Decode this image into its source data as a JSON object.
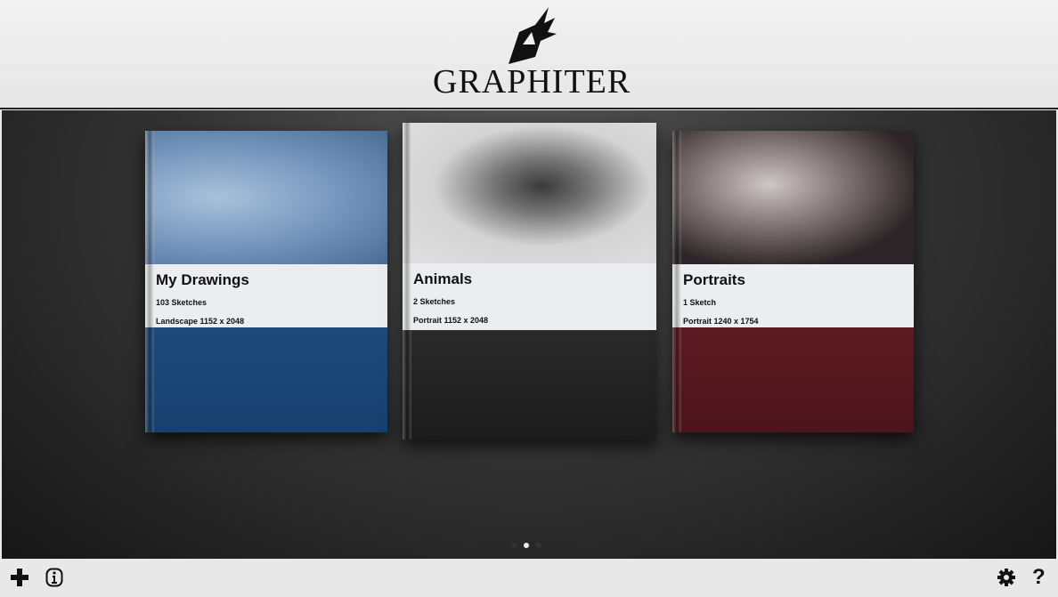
{
  "app": {
    "title": "GRAPHITER"
  },
  "books": [
    {
      "title": "My Drawings",
      "count": "103 Sketches",
      "format": "Landscape 1152 x 2048",
      "cover_color": "#1d4677",
      "art_color": "#7fa0c6"
    },
    {
      "title": "Animals",
      "count": "2 Sketches",
      "format": "Portrait 1152 x 2048",
      "cover_color": "#222222",
      "art_color": "#cfcfcf"
    },
    {
      "title": "Portraits",
      "count": "1 Sketch",
      "format": "Portrait 1240 x 1754",
      "cover_color": "#5a1820",
      "art_color": "#3a3234"
    }
  ],
  "pager": {
    "pages": 3,
    "current": 2
  },
  "footer": {
    "add_icon": "plus-icon",
    "info_icon": "info-icon",
    "settings_icon": "gear-icon",
    "help_icon": "question-icon",
    "help_label": "?"
  }
}
